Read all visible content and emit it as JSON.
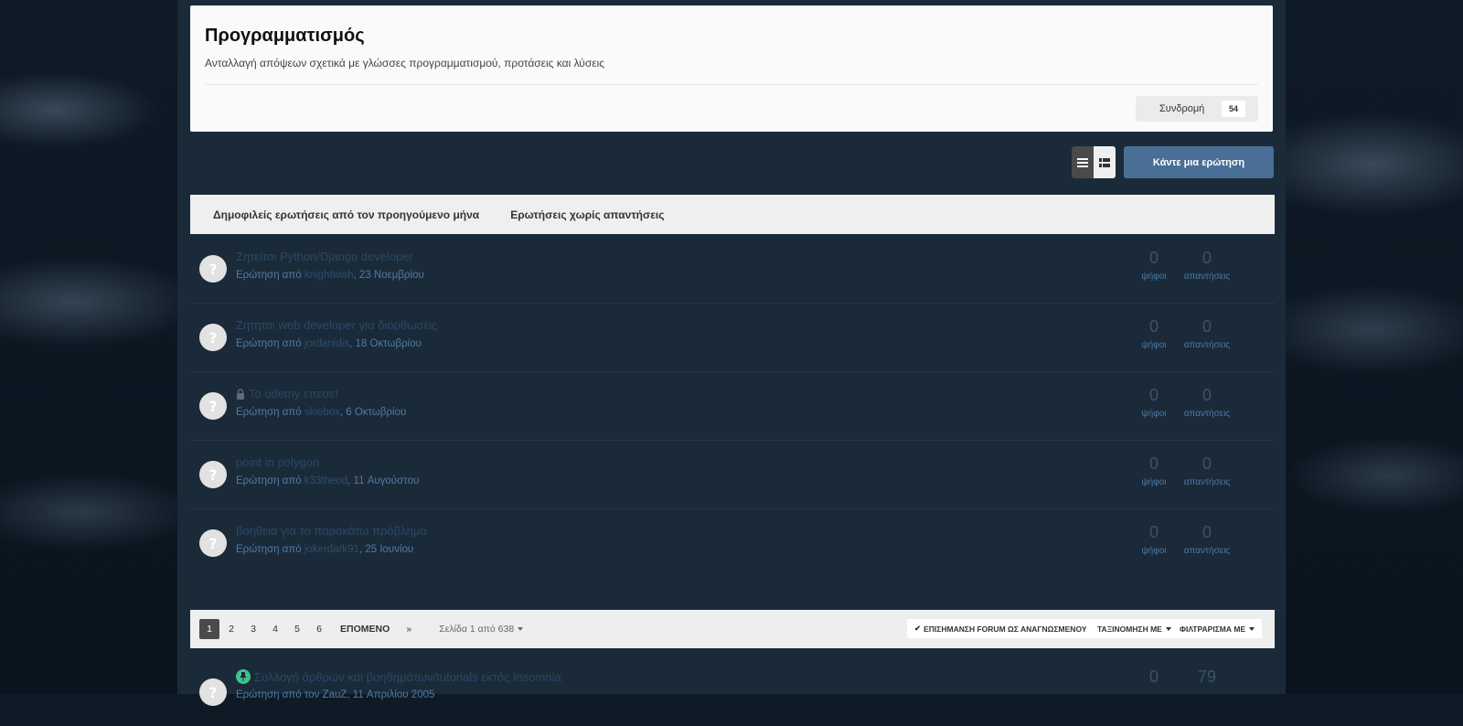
{
  "header": {
    "title": "Προγραμματισμός",
    "description": "Ανταλλαγή απόψεων σχετικά με γλώσσες προγραμματισμού, προτάσεις και λύσεις",
    "follow_label": "Συνδρομή",
    "follow_count": "54"
  },
  "toolbar": {
    "ask_label": "Κάντε μια ερώτηση"
  },
  "tabs": [
    {
      "label": "Δημοφιλείς ερωτήσεις από τον προηγούμενο μήνα"
    },
    {
      "label": "Ερωτήσεις χωρίς απαντήσεις"
    }
  ],
  "stat_labels": {
    "votes": "ψήφοι",
    "answers": "απαντήσεις"
  },
  "questions": [
    {
      "title": "Ζητείται Python/Django developer",
      "prefix": "Ερώτηση από ",
      "author": "knightwish",
      "date": ", 23 Νοεμβρίου",
      "votes": "0",
      "answers": "0",
      "locked": false
    },
    {
      "title": "Ζητηται web developer για διορθωσεις",
      "prefix": "Ερώτηση από ",
      "author": "jordanidis",
      "date": ", 18 Οκτωβρίου",
      "votes": "0",
      "answers": "0",
      "locked": false
    },
    {
      "title": "Το udemy επεσε!",
      "prefix": "Ερώτηση από ",
      "author": "skiebox",
      "date": ", 6 Οκτωβρίου",
      "votes": "0",
      "answers": "0",
      "locked": true
    },
    {
      "title": "point in polygon",
      "prefix": "Ερώτηση από ",
      "author": "k33theod",
      "date": ", 11 Αυγούστου",
      "votes": "0",
      "answers": "0",
      "locked": false
    },
    {
      "title": "βοηθεια για το παρακάτω πρόβλημα",
      "prefix": "Ερώτηση από ",
      "author": "jokerdark91",
      "date": ", 25 Ιουνίου",
      "votes": "0",
      "answers": "0",
      "locked": false
    }
  ],
  "pagination": {
    "pages": [
      "1",
      "2",
      "3",
      "4",
      "5",
      "6"
    ],
    "next_label": "ΕΠΟΜΕΝΟ",
    "last_label": "»",
    "page_of": "Σελίδα 1 από 638",
    "mark_read_label": "ΕΠΙΣΗΜΑΝΣΗ FORUM ΩΣ ΑΝΑΓΝΩΣΜΕΝΟΥ",
    "sort_label": "ΤΑΞΙΝΟΜΗΣΗ ΜΕ",
    "filter_label": "ΦΙΛΤΡΑΡΙΣΜΑ ΜΕ"
  },
  "pinned": {
    "title": "Συλλογή άρθρων και βοηθημάτων/tutorials εκτός Insomnia",
    "meta": "Ερώτηση από τον ZauZ, 11 Απριλίου 2005",
    "votes": "0",
    "answers": "79"
  },
  "colors": {
    "content_bg": "#1b2a39",
    "accent": "#4a6f96",
    "link": "#4f7ba4",
    "pinned": "#3ec28f"
  }
}
